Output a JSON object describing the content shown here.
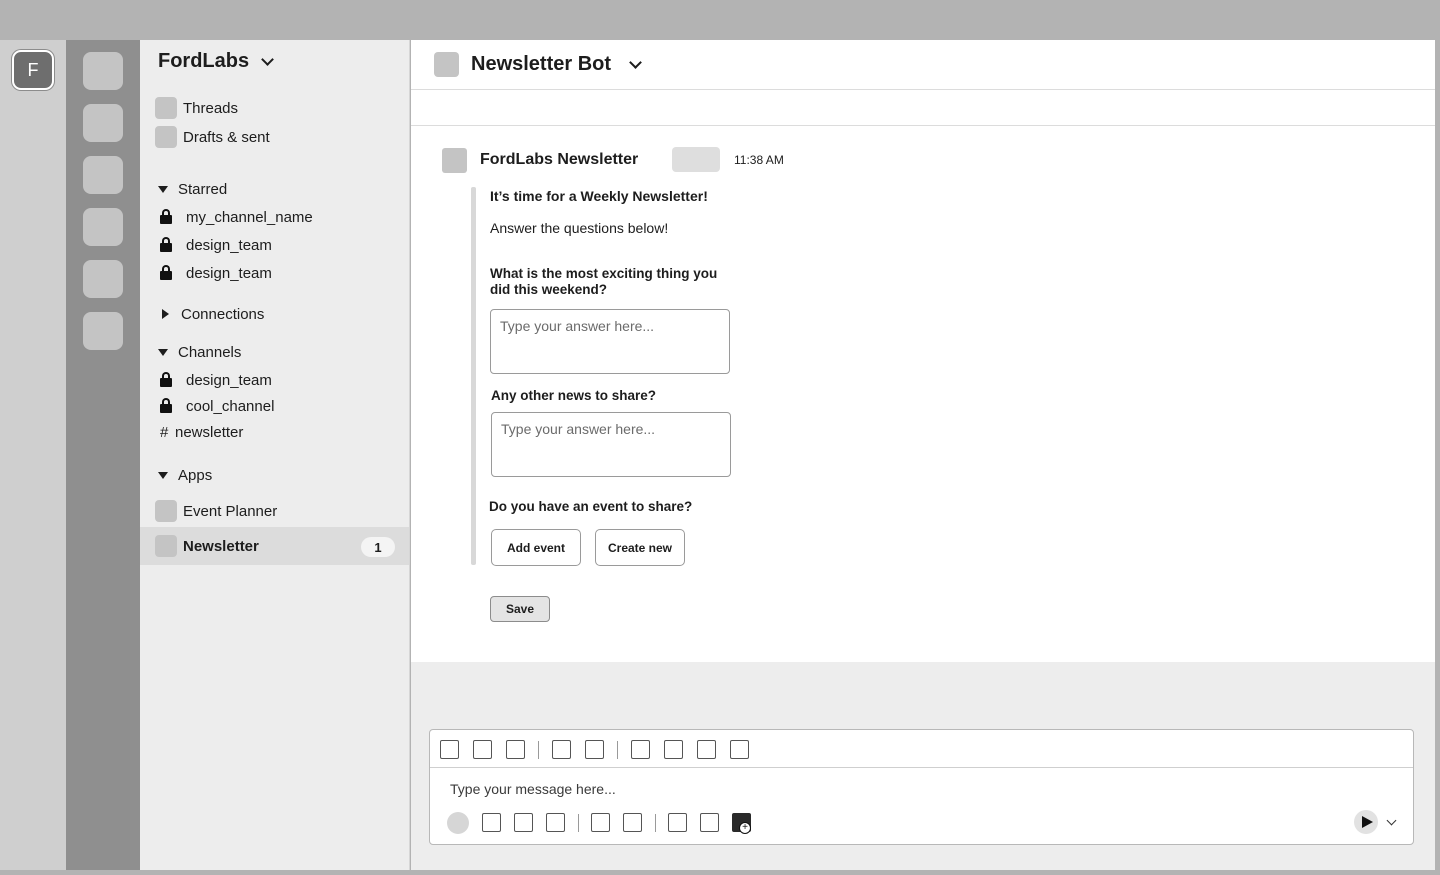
{
  "workspace_rail": {
    "initial": "F"
  },
  "sidebar": {
    "workspace_name": "FordLabs",
    "top_items": [
      {
        "label": "Threads"
      },
      {
        "label": "Drafts & sent"
      }
    ],
    "starred": {
      "label": "Starred",
      "items": [
        {
          "label": "my_channel_name"
        },
        {
          "label": "design_team"
        },
        {
          "label": "design_team"
        }
      ]
    },
    "connections": {
      "label": "Connections"
    },
    "channels": {
      "label": "Channels",
      "items": [
        {
          "label": "design_team",
          "icon": "lock-icon"
        },
        {
          "label": "cool_channel",
          "icon": "lock-icon"
        },
        {
          "label": "newsletter",
          "icon": "hash-icon",
          "prefix": "#"
        }
      ]
    },
    "apps": {
      "label": "Apps",
      "items": [
        {
          "label": "Event Planner"
        },
        {
          "label": "Newsletter",
          "badge": "1"
        }
      ]
    }
  },
  "header": {
    "title": "Newsletter Bot"
  },
  "message": {
    "author": "FordLabs Newsletter",
    "time": "11:38 AM",
    "heading": "It’s time for a Weekly Newsletter!",
    "intro": "Answer the questions below!",
    "q1": "What is the most exciting thing you did this weekend?",
    "q1_placeholder": "Type your answer here...",
    "q2": "Any other news to share?",
    "q2_placeholder": "Type your answer here...",
    "q3": "Do you have an event to share?",
    "add_event": "Add event",
    "create_new": "Create new",
    "save": "Save"
  },
  "composer": {
    "placeholder": "Type your message here..."
  }
}
